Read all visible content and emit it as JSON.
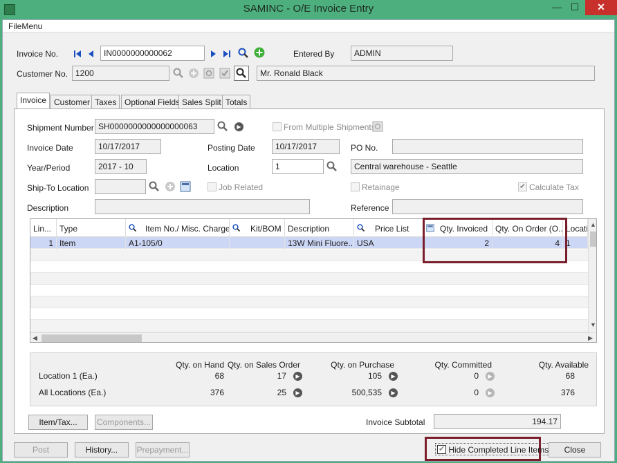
{
  "window": {
    "title": "SAMINC - O/E Invoice Entry",
    "minimize": "—",
    "maximize": "☐",
    "close": "✕"
  },
  "menu": {
    "file": "FileMenu"
  },
  "header": {
    "invoice_no_label": "Invoice No.",
    "invoice_no": "IN0000000000062",
    "entered_by_label": "Entered By",
    "entered_by": "ADMIN",
    "customer_no_label": "Customer No.",
    "customer_no": "1200",
    "customer_name": "Mr. Ronald Black"
  },
  "tabs": [
    "Invoice",
    "Customer",
    "Taxes",
    "Optional Fields",
    "Sales Split",
    "Totals"
  ],
  "invoice": {
    "shipment_number_label": "Shipment Number",
    "shipment_number": "SH0000000000000000063",
    "from_multiple_shipments": "From Multiple Shipments",
    "invoice_date_label": "Invoice Date",
    "invoice_date": "10/17/2017",
    "posting_date_label": "Posting Date",
    "posting_date": "10/17/2017",
    "po_no_label": "PO No.",
    "po_no": "",
    "year_period_label": "Year/Period",
    "year_period": "2017 - 10",
    "location_label": "Location",
    "location": "1",
    "location_desc": "Central warehouse - Seattle",
    "ship_to_label": "Ship-To Location",
    "ship_to": "",
    "job_related": "Job Related",
    "retainage": "Retainage",
    "calculate_tax": "Calculate Tax",
    "description_label": "Description",
    "description": "",
    "reference_label": "Reference",
    "reference": ""
  },
  "grid": {
    "columns": [
      "Lin...",
      "Type",
      "Item No./ Misc. Charge",
      "Kit/BOM",
      "Description",
      "Price List",
      "Qty. Invoiced",
      "Qty. On Order (O...",
      "Locati"
    ],
    "rows": [
      {
        "line": "1",
        "type": "Item",
        "item": "A1-105/0",
        "kit": "",
        "description": "13W Mini Fluore...",
        "price_list": "USA",
        "qty_invoiced": "2",
        "qty_on_order": "4",
        "location": "1"
      }
    ]
  },
  "stock": {
    "headers": [
      "Qty. on Hand",
      "Qty. on Sales Order",
      "Qty. on Purchase",
      "Qty. Committed",
      "Qty. Available"
    ],
    "rows": [
      {
        "label": "Location  1 (Ea.)",
        "values": [
          "68",
          "17",
          "105",
          "0",
          "68"
        ]
      },
      {
        "label": "All Locations (Ea.)",
        "values": [
          "376",
          "25",
          "500,535",
          "0",
          "376"
        ]
      }
    ]
  },
  "bottom": {
    "item_tax": "Item/Tax...",
    "components": "Components...",
    "invoice_subtotal_label": "Invoice Subtotal",
    "invoice_subtotal": "194.17"
  },
  "footer": {
    "post": "Post",
    "history": "History...",
    "prepayment": "Prepayment...",
    "hide_completed": "Hide Completed Line Items",
    "close": "Close"
  }
}
